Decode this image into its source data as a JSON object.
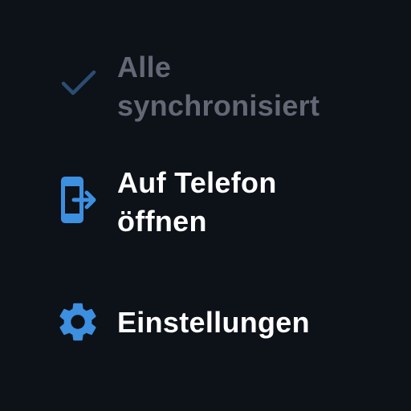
{
  "menu": {
    "items": [
      {
        "id": "sync",
        "label": "Alle\nsynchronisiert",
        "icon": "checkmark-icon",
        "state": "disabled"
      },
      {
        "id": "open_on_phone",
        "label": "Auf Telefon\nöffnen",
        "icon": "open-on-phone-icon",
        "state": "enabled"
      },
      {
        "id": "settings",
        "label": "Einstellungen",
        "icon": "gear-icon",
        "state": "enabled"
      }
    ]
  },
  "colors": {
    "background": "#0d1118",
    "accent": "#3d8fe0",
    "disabled_text": "#626874",
    "disabled_icon": "#2b4d72",
    "text": "#ffffff"
  }
}
